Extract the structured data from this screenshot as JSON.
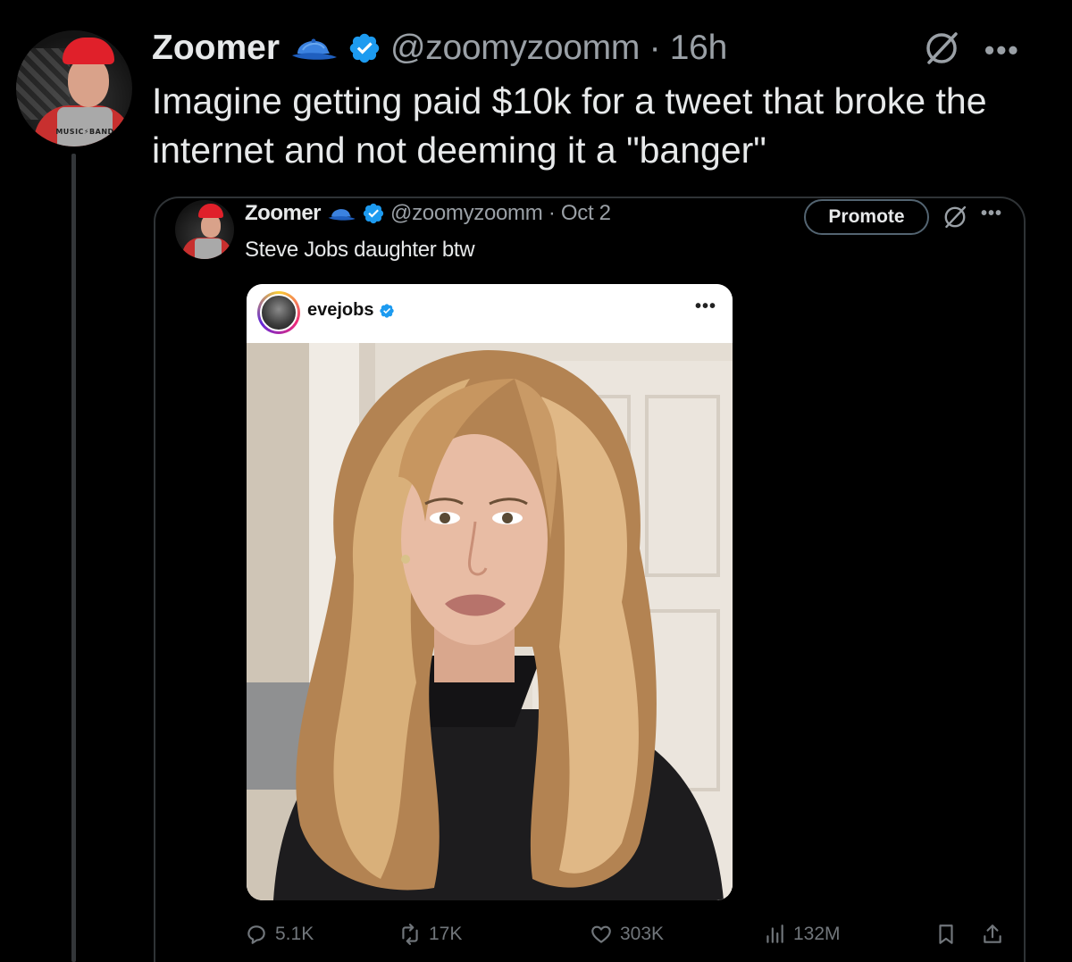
{
  "tweet": {
    "display_name": "Zoomer",
    "handle_time": "@zoomyzoomm · 16h",
    "text": "Imagine getting paid $10k for a tweet that broke the internet and not deeming it a \"banger\"",
    "avatar_shirt_text": "MUSIC⚡BAND"
  },
  "quoted": {
    "display_name": "Zoomer",
    "handle_date": "@zoomyzoomm · Oct 2",
    "text": "Steve Jobs daughter btw",
    "promote_label": "Promote",
    "embedded_post": {
      "username": "evejobs"
    }
  },
  "actions": {
    "replies": "5.1K",
    "reposts": "17K",
    "likes": "303K",
    "views": "132M"
  },
  "icons": {
    "cap": "blue-cap-emoji-icon",
    "verified": "verified-badge-icon",
    "grok": "grok-icon",
    "more": "more-icon",
    "reply": "reply-icon",
    "repost": "repost-icon",
    "like": "heart-icon",
    "views": "views-chart-icon",
    "bookmark": "bookmark-icon",
    "share": "share-icon"
  },
  "colors": {
    "background": "#000000",
    "text_primary": "#e7e9ea",
    "text_secondary": "#71767b",
    "border": "#2f3336",
    "verified_blue": "#1d9bf0"
  }
}
